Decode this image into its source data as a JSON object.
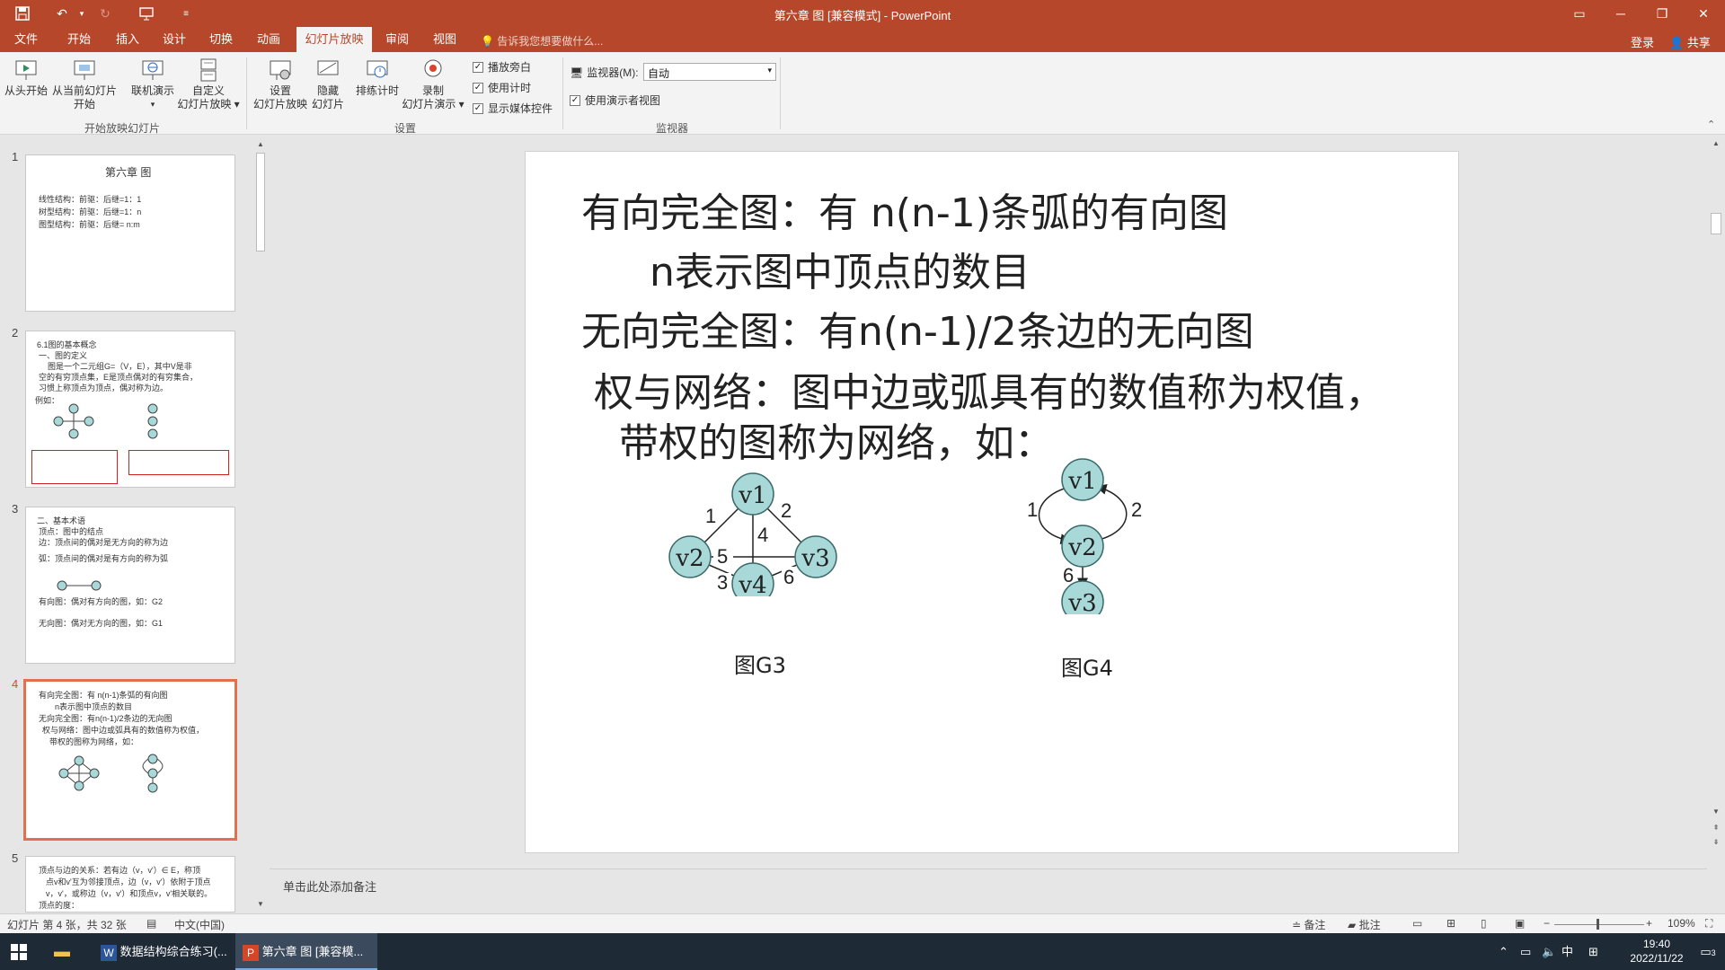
{
  "window": {
    "title": "第六章 图 [兼容模式] - PowerPoint",
    "quick_access": [
      "save-icon",
      "undo-icon",
      "redo-icon",
      "presentation-icon",
      "customize-icon"
    ]
  },
  "tabs": [
    "文件",
    "开始",
    "插入",
    "设计",
    "切换",
    "动画",
    "幻灯片放映",
    "审阅",
    "视图"
  ],
  "active_tab": "幻灯片放映",
  "tell_me": "告诉我您想要做什么...",
  "account": {
    "login": "登录",
    "share": "共享"
  },
  "ribbon": {
    "start_group": {
      "label": "开始放映幻灯片",
      "from_start": "从头开始",
      "from_current_1": "从当前幻灯片",
      "from_current_2": "开始",
      "online_1": "联机演示",
      "custom_1": "自定义",
      "custom_2": "幻灯片放映"
    },
    "setup_group": {
      "label": "设置",
      "setup_1": "设置",
      "setup_2": "幻灯片放映",
      "hide_1": "隐藏",
      "hide_2": "幻灯片",
      "rehearse": "排练计时",
      "record_1": "录制",
      "record_2": "幻灯片演示",
      "play_narration": "播放旁白",
      "use_timings": "使用计时",
      "show_media": "显示媒体控件"
    },
    "monitor_group": {
      "label": "监视器",
      "monitor_label": "监视器(M):",
      "monitor_value": "自动",
      "presenter_view": "使用演示者视图"
    }
  },
  "thumbnails": [
    {
      "num": "1",
      "lines": [
        "第六章 图",
        "线性结构：前驱：后继=1：1",
        "树型结构：前驱：后继=1：n",
        "图型结构：前驱：后继= n:m"
      ]
    },
    {
      "num": "2",
      "lines": [
        "6.1图的基本概念",
        "一、图的定义",
        "图是一个二元组G=（V，E），其中V是非",
        "空的有穷顶点集，E是顶点偶对的有穷集合，",
        "习惯上称顶点为顶点，偶对称为边。",
        "例如："
      ]
    },
    {
      "num": "3",
      "lines": [
        "二、基本术语",
        "顶点：图中的结点",
        "边：顶点间的偶对是无方向的称为边",
        "弧：顶点间的偶对是有方向的称为弧",
        "有向图：偶对有方向的图，如：G2",
        "无向图：偶对无方向的图，如：G1"
      ]
    },
    {
      "num": "4",
      "lines": [
        "有向完全图：有 n(n-1)条弧的有向图",
        "n表示图中顶点的数目",
        "无向完全图：有n(n-1)/2条边的无向图",
        "权与网络：图中边或弧具有的数值称为权值，",
        "带权的图称为网络，如："
      ]
    },
    {
      "num": "5",
      "lines": [
        "顶点与边的关系：若有边（v，v'）∈ E，称顶",
        "点v和v'互为邻接顶点，边（v，v'）依附于顶点",
        "v，v'，或称边（v，v'）和顶点v，v'相关联的。",
        "顶点的度："
      ]
    }
  ],
  "slide": {
    "line1": "有向完全图：有 n(n-1)条弧的有向图",
    "line2": "n表示图中顶点的数目",
    "line3": "无向完全图：有n(n-1)/2条边的无向图",
    "line4": "权与网络：图中边或弧具有的数值称为权值，",
    "line5": "带权的图称为网络，如：",
    "g3": {
      "caption": "图G3",
      "nodes": [
        "v1",
        "v2",
        "v3",
        "v4"
      ],
      "weights": [
        "1",
        "2",
        "5",
        "4",
        "3",
        "6"
      ]
    },
    "g4": {
      "caption": "图G4",
      "nodes": [
        "v1",
        "v2",
        "v3"
      ],
      "weights": [
        "1",
        "2",
        "6"
      ]
    }
  },
  "notes_placeholder": "单击此处添加备注",
  "status": {
    "slide_info": "幻灯片 第 4 张，共 32 张",
    "language": "中文(中国)",
    "notes": "备注",
    "comments": "批注",
    "zoom": "109%"
  },
  "taskbar": {
    "word_task": "数据结构综合练习(...",
    "ppt_task": "第六章 图 [兼容模...",
    "ime": "中",
    "time": "19:40",
    "date": "2022/11/22",
    "notification_count": "3"
  },
  "colors": {
    "accent": "#b7472a",
    "node_fill": "#a9d8d8",
    "selected_thumb": "#e07050"
  }
}
